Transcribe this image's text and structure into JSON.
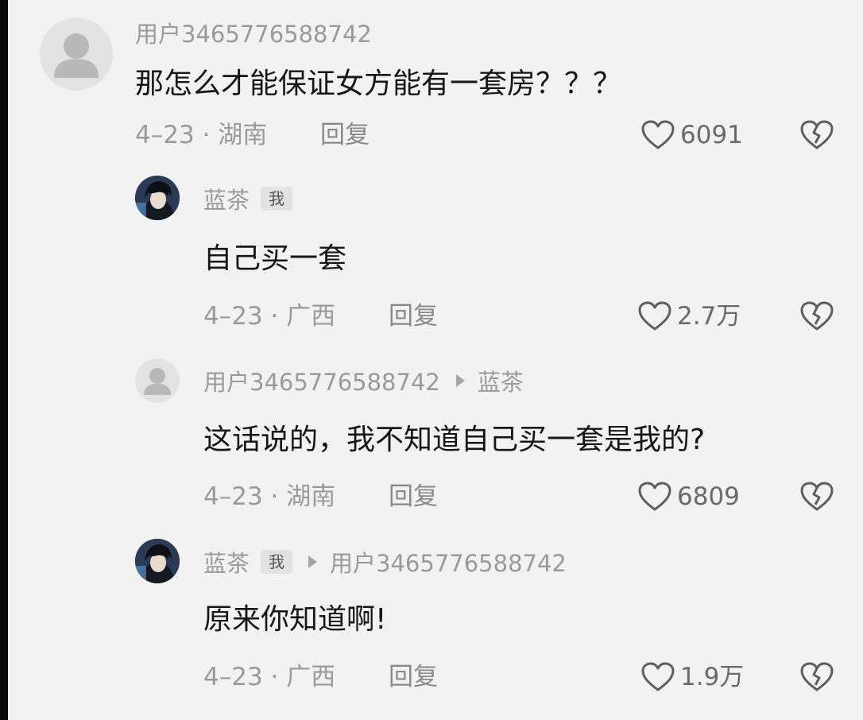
{
  "comments": [
    {
      "username": "用户3465776588742",
      "text": "那怎么才能保证女方能有一套房？？？",
      "date_location": "4–23 · 湖南",
      "reply_label": "回复",
      "likes": "6091"
    },
    {
      "username": "蓝茶",
      "badge": "我",
      "text": "自己买一套",
      "date_location": "4–23 · 广西",
      "reply_label": "回复",
      "likes": "2.7万"
    },
    {
      "username": "用户3465776588742",
      "reply_to": "蓝茶",
      "text": "这话说的，我不知道自己买一套是我的?",
      "date_location": "4–23 · 湖南",
      "reply_label": "回复",
      "likes": "6809"
    },
    {
      "username": "蓝茶",
      "badge": "我",
      "reply_to": "用户3465776588742",
      "text": "原来你知道啊!",
      "date_location": "4–23 · 广西",
      "reply_label": "回复",
      "likes": "1.9万"
    }
  ],
  "colors": {
    "background": "#f2f2f2",
    "meta_text": "#9a9a9a",
    "body_text": "#161616",
    "badge_bg": "#e2e2e2"
  },
  "icons": {
    "like": "heart-outline-icon",
    "dislike": "broken-heart-icon",
    "reply_arrow": "triangle-right-icon",
    "default_avatar": "person-silhouette-icon"
  }
}
